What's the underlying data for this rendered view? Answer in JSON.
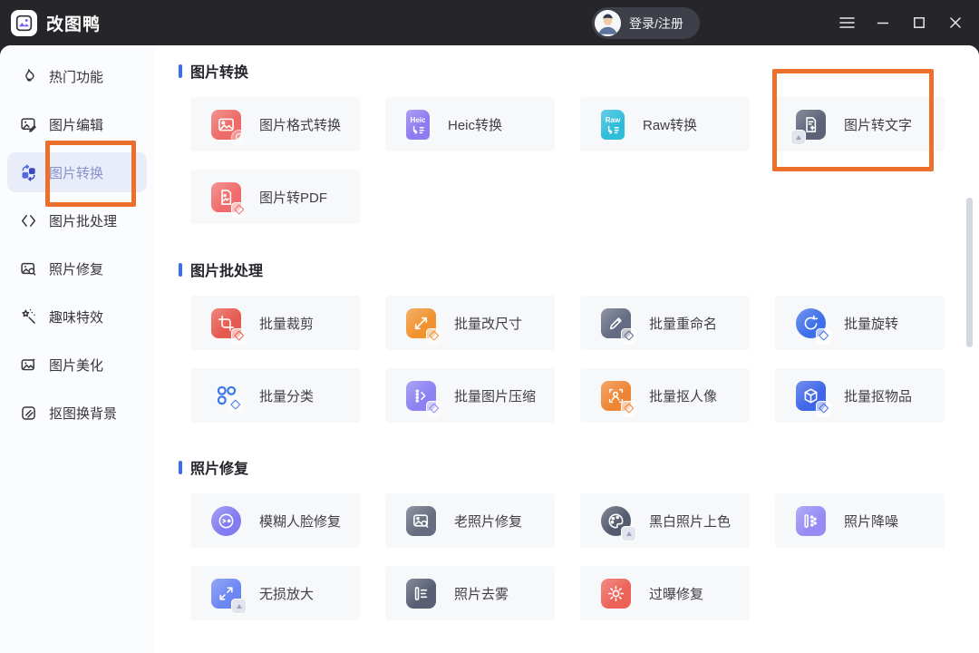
{
  "titlebar": {
    "app_name": "改图鸭",
    "login_label": "登录/注册"
  },
  "sidebar": {
    "items": [
      {
        "label": "热门功能",
        "icon": "flame-icon",
        "selected": false
      },
      {
        "label": "图片编辑",
        "icon": "image-edit-icon",
        "selected": false
      },
      {
        "label": "图片转换",
        "icon": "convert-swap-icon",
        "selected": true,
        "annotated": true
      },
      {
        "label": "图片批处理",
        "icon": "batch-brackets-icon",
        "selected": false
      },
      {
        "label": "照片修复",
        "icon": "photo-repair-icon",
        "selected": false
      },
      {
        "label": "趣味特效",
        "icon": "magic-wand-icon",
        "selected": false
      },
      {
        "label": "图片美化",
        "icon": "image-beautify-icon",
        "selected": false
      },
      {
        "label": "抠图换背景",
        "icon": "cutout-background-icon",
        "selected": false
      }
    ]
  },
  "sections": [
    {
      "title": "图片转换",
      "items": [
        {
          "label": "图片格式转换",
          "icon": "image-format-convert-icon",
          "color": "#ed6a66"
        },
        {
          "label": "Heic转换",
          "icon": "heic-file-icon",
          "file_label": "Heic",
          "color": "#8d7bf0"
        },
        {
          "label": "Raw转换",
          "icon": "raw-file-icon",
          "file_label": "Raw",
          "color": "#2fbcd9"
        },
        {
          "label": "图片转文字",
          "icon": "image-to-text-icon",
          "color": "#5c6278",
          "annotated": true
        },
        {
          "label": "图片转PDF",
          "icon": "image-to-pdf-icon",
          "color": "#f06b6b"
        }
      ]
    },
    {
      "title": "图片批处理",
      "items": [
        {
          "label": "批量裁剪",
          "icon": "batch-crop-icon",
          "color": "#e55a4e"
        },
        {
          "label": "批量改尺寸",
          "icon": "batch-resize-icon",
          "color": "#f0922e"
        },
        {
          "label": "批量重命名",
          "icon": "batch-rename-icon",
          "color": "#646b82"
        },
        {
          "label": "批量旋转",
          "icon": "batch-rotate-icon",
          "color": "#3f6fe8"
        },
        {
          "label": "批量分类",
          "icon": "batch-classify-icon",
          "color": "#3a76e6"
        },
        {
          "label": "批量图片压缩",
          "icon": "batch-compress-icon",
          "color": "#8c81f2"
        },
        {
          "label": "批量抠人像",
          "icon": "batch-portrait-cutout-icon",
          "color": "#ee8534"
        },
        {
          "label": "批量抠物品",
          "icon": "batch-object-cutout-icon",
          "color": "#3f66e8"
        }
      ]
    },
    {
      "title": "照片修复",
      "items": [
        {
          "label": "模糊人脸修复",
          "icon": "blurry-face-repair-icon",
          "color": "#837cf0"
        },
        {
          "label": "老照片修复",
          "icon": "old-photo-repair-icon",
          "color": "#666d80"
        },
        {
          "label": "黑白照片上色",
          "icon": "bw-photo-colorize-icon",
          "color": "#555b6e"
        },
        {
          "label": "照片降噪",
          "icon": "photo-denoise-icon",
          "color": "#968cf4"
        },
        {
          "label": "无损放大",
          "icon": "lossless-enlarge-icon",
          "color": "#6c86f2"
        },
        {
          "label": "照片去雾",
          "icon": "photo-dehaze-icon",
          "color": "#585f74"
        },
        {
          "label": "过曝修复",
          "icon": "overexposure-repair-icon",
          "color": "#ec6258"
        }
      ]
    }
  ],
  "annotations": {
    "color": "#ec6f2c",
    "targets": [
      "sidebar-图片转换",
      "card-图片转文字"
    ]
  },
  "colors": {
    "titlebar_bg": "#26262a",
    "accent_blue": "#3e6cf0",
    "card_bg": "#f7f8fa",
    "sidebar_selected_bg": "#e9ecf9",
    "sidebar_selected_text": "#8992cf"
  }
}
